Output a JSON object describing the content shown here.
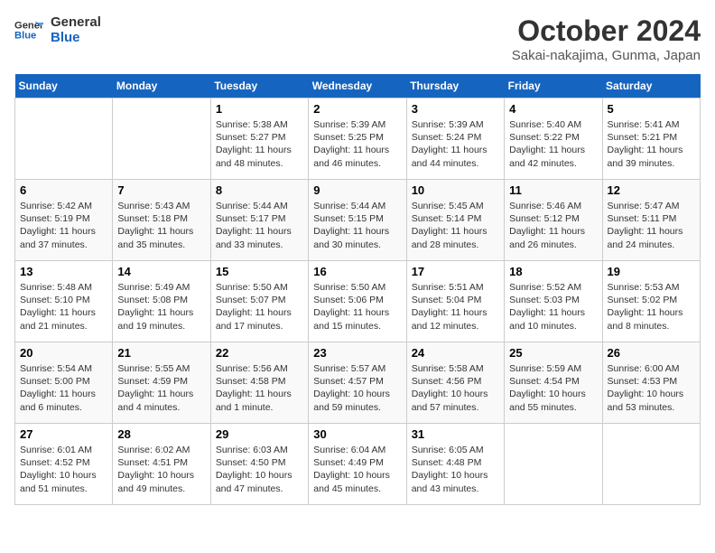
{
  "header": {
    "logo_line1": "General",
    "logo_line2": "Blue",
    "month": "October 2024",
    "location": "Sakai-nakajima, Gunma, Japan"
  },
  "days_of_week": [
    "Sunday",
    "Monday",
    "Tuesday",
    "Wednesday",
    "Thursday",
    "Friday",
    "Saturday"
  ],
  "weeks": [
    [
      {
        "day": "",
        "data": ""
      },
      {
        "day": "",
        "data": ""
      },
      {
        "day": "1",
        "data": "Sunrise: 5:38 AM\nSunset: 5:27 PM\nDaylight: 11 hours and 48 minutes."
      },
      {
        "day": "2",
        "data": "Sunrise: 5:39 AM\nSunset: 5:25 PM\nDaylight: 11 hours and 46 minutes."
      },
      {
        "day": "3",
        "data": "Sunrise: 5:39 AM\nSunset: 5:24 PM\nDaylight: 11 hours and 44 minutes."
      },
      {
        "day": "4",
        "data": "Sunrise: 5:40 AM\nSunset: 5:22 PM\nDaylight: 11 hours and 42 minutes."
      },
      {
        "day": "5",
        "data": "Sunrise: 5:41 AM\nSunset: 5:21 PM\nDaylight: 11 hours and 39 minutes."
      }
    ],
    [
      {
        "day": "6",
        "data": "Sunrise: 5:42 AM\nSunset: 5:19 PM\nDaylight: 11 hours and 37 minutes."
      },
      {
        "day": "7",
        "data": "Sunrise: 5:43 AM\nSunset: 5:18 PM\nDaylight: 11 hours and 35 minutes."
      },
      {
        "day": "8",
        "data": "Sunrise: 5:44 AM\nSunset: 5:17 PM\nDaylight: 11 hours and 33 minutes."
      },
      {
        "day": "9",
        "data": "Sunrise: 5:44 AM\nSunset: 5:15 PM\nDaylight: 11 hours and 30 minutes."
      },
      {
        "day": "10",
        "data": "Sunrise: 5:45 AM\nSunset: 5:14 PM\nDaylight: 11 hours and 28 minutes."
      },
      {
        "day": "11",
        "data": "Sunrise: 5:46 AM\nSunset: 5:12 PM\nDaylight: 11 hours and 26 minutes."
      },
      {
        "day": "12",
        "data": "Sunrise: 5:47 AM\nSunset: 5:11 PM\nDaylight: 11 hours and 24 minutes."
      }
    ],
    [
      {
        "day": "13",
        "data": "Sunrise: 5:48 AM\nSunset: 5:10 PM\nDaylight: 11 hours and 21 minutes."
      },
      {
        "day": "14",
        "data": "Sunrise: 5:49 AM\nSunset: 5:08 PM\nDaylight: 11 hours and 19 minutes."
      },
      {
        "day": "15",
        "data": "Sunrise: 5:50 AM\nSunset: 5:07 PM\nDaylight: 11 hours and 17 minutes."
      },
      {
        "day": "16",
        "data": "Sunrise: 5:50 AM\nSunset: 5:06 PM\nDaylight: 11 hours and 15 minutes."
      },
      {
        "day": "17",
        "data": "Sunrise: 5:51 AM\nSunset: 5:04 PM\nDaylight: 11 hours and 12 minutes."
      },
      {
        "day": "18",
        "data": "Sunrise: 5:52 AM\nSunset: 5:03 PM\nDaylight: 11 hours and 10 minutes."
      },
      {
        "day": "19",
        "data": "Sunrise: 5:53 AM\nSunset: 5:02 PM\nDaylight: 11 hours and 8 minutes."
      }
    ],
    [
      {
        "day": "20",
        "data": "Sunrise: 5:54 AM\nSunset: 5:00 PM\nDaylight: 11 hours and 6 minutes."
      },
      {
        "day": "21",
        "data": "Sunrise: 5:55 AM\nSunset: 4:59 PM\nDaylight: 11 hours and 4 minutes."
      },
      {
        "day": "22",
        "data": "Sunrise: 5:56 AM\nSunset: 4:58 PM\nDaylight: 11 hours and 1 minute."
      },
      {
        "day": "23",
        "data": "Sunrise: 5:57 AM\nSunset: 4:57 PM\nDaylight: 10 hours and 59 minutes."
      },
      {
        "day": "24",
        "data": "Sunrise: 5:58 AM\nSunset: 4:56 PM\nDaylight: 10 hours and 57 minutes."
      },
      {
        "day": "25",
        "data": "Sunrise: 5:59 AM\nSunset: 4:54 PM\nDaylight: 10 hours and 55 minutes."
      },
      {
        "day": "26",
        "data": "Sunrise: 6:00 AM\nSunset: 4:53 PM\nDaylight: 10 hours and 53 minutes."
      }
    ],
    [
      {
        "day": "27",
        "data": "Sunrise: 6:01 AM\nSunset: 4:52 PM\nDaylight: 10 hours and 51 minutes."
      },
      {
        "day": "28",
        "data": "Sunrise: 6:02 AM\nSunset: 4:51 PM\nDaylight: 10 hours and 49 minutes."
      },
      {
        "day": "29",
        "data": "Sunrise: 6:03 AM\nSunset: 4:50 PM\nDaylight: 10 hours and 47 minutes."
      },
      {
        "day": "30",
        "data": "Sunrise: 6:04 AM\nSunset: 4:49 PM\nDaylight: 10 hours and 45 minutes."
      },
      {
        "day": "31",
        "data": "Sunrise: 6:05 AM\nSunset: 4:48 PM\nDaylight: 10 hours and 43 minutes."
      },
      {
        "day": "",
        "data": ""
      },
      {
        "day": "",
        "data": ""
      }
    ]
  ]
}
